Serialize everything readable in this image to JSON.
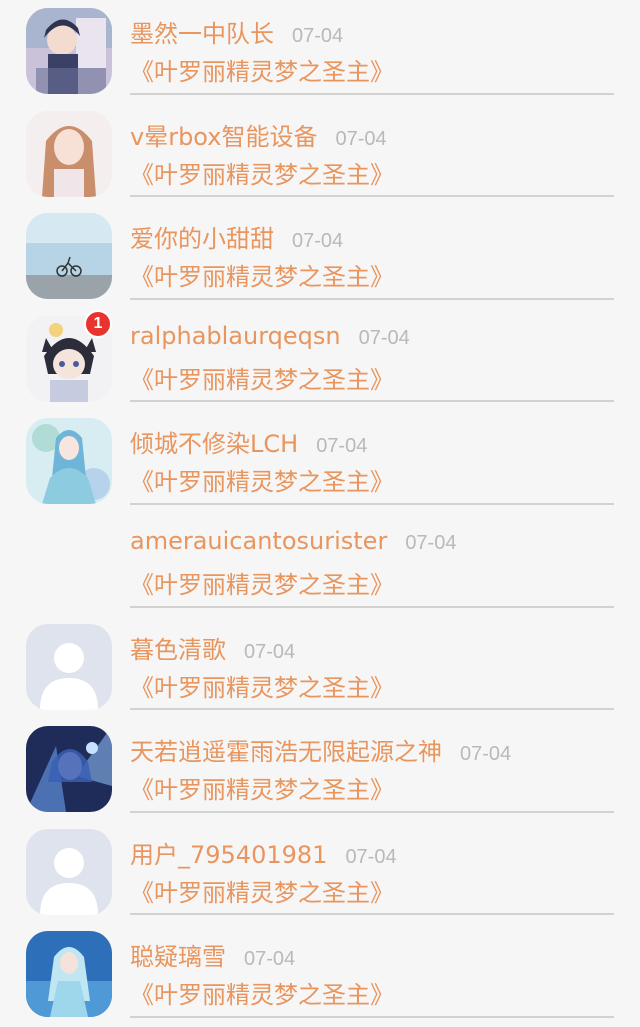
{
  "rows": [
    {
      "name": "墨然一中队长",
      "date": "07-04",
      "book": "《叶罗丽精灵梦之圣主》",
      "avatar": "anime-boy-avatar",
      "badge": null
    },
    {
      "name": "v晕rbox智能设备",
      "date": "07-04",
      "book": "《叶罗丽精灵梦之圣主》",
      "avatar": "girl-photo-avatar",
      "badge": null
    },
    {
      "name": "爱你的小甜甜",
      "date": "07-04",
      "book": "《叶罗丽精灵梦之圣主》",
      "avatar": "bicycle-sky-avatar",
      "badge": null
    },
    {
      "name": "ralphablaurqeqsn",
      "date": "07-04",
      "book": "《叶罗丽精灵梦之圣主》",
      "avatar": "anime-cat-boy-avatar",
      "badge": "1"
    },
    {
      "name": "倾城不修染LCH",
      "date": "07-04",
      "book": "《叶罗丽精灵梦之圣主》",
      "avatar": "anime-fairy-avatar",
      "badge": null
    },
    {
      "name": "amerauicantosurister",
      "date": "07-04",
      "book": "《叶罗丽精灵梦之圣主》",
      "avatar": "blank-avatar",
      "badge": null
    },
    {
      "name": "暮色清歌",
      "date": "07-04",
      "book": "《叶罗丽精灵梦之圣主》",
      "avatar": "default-user-avatar",
      "badge": null
    },
    {
      "name": "天若逍遥霍雨浩无限起源之神",
      "date": "07-04",
      "book": "《叶罗丽精灵梦之圣主》",
      "avatar": "anime-blue-hair-avatar",
      "badge": null
    },
    {
      "name": "用户_795401981",
      "date": "07-04",
      "book": "《叶罗丽精灵梦之圣主》",
      "avatar": "default-user-avatar",
      "badge": null
    },
    {
      "name": "聪疑璃雪",
      "date": "07-04",
      "book": "《叶罗丽精灵梦之圣主》",
      "avatar": "anime-princess-avatar",
      "badge": null
    }
  ],
  "colors": {
    "accent": "#e8955e",
    "date": "#b9b9b9",
    "divider": "#d2d2d2",
    "badge": "#e8332f",
    "background": "#f6f6f6"
  }
}
